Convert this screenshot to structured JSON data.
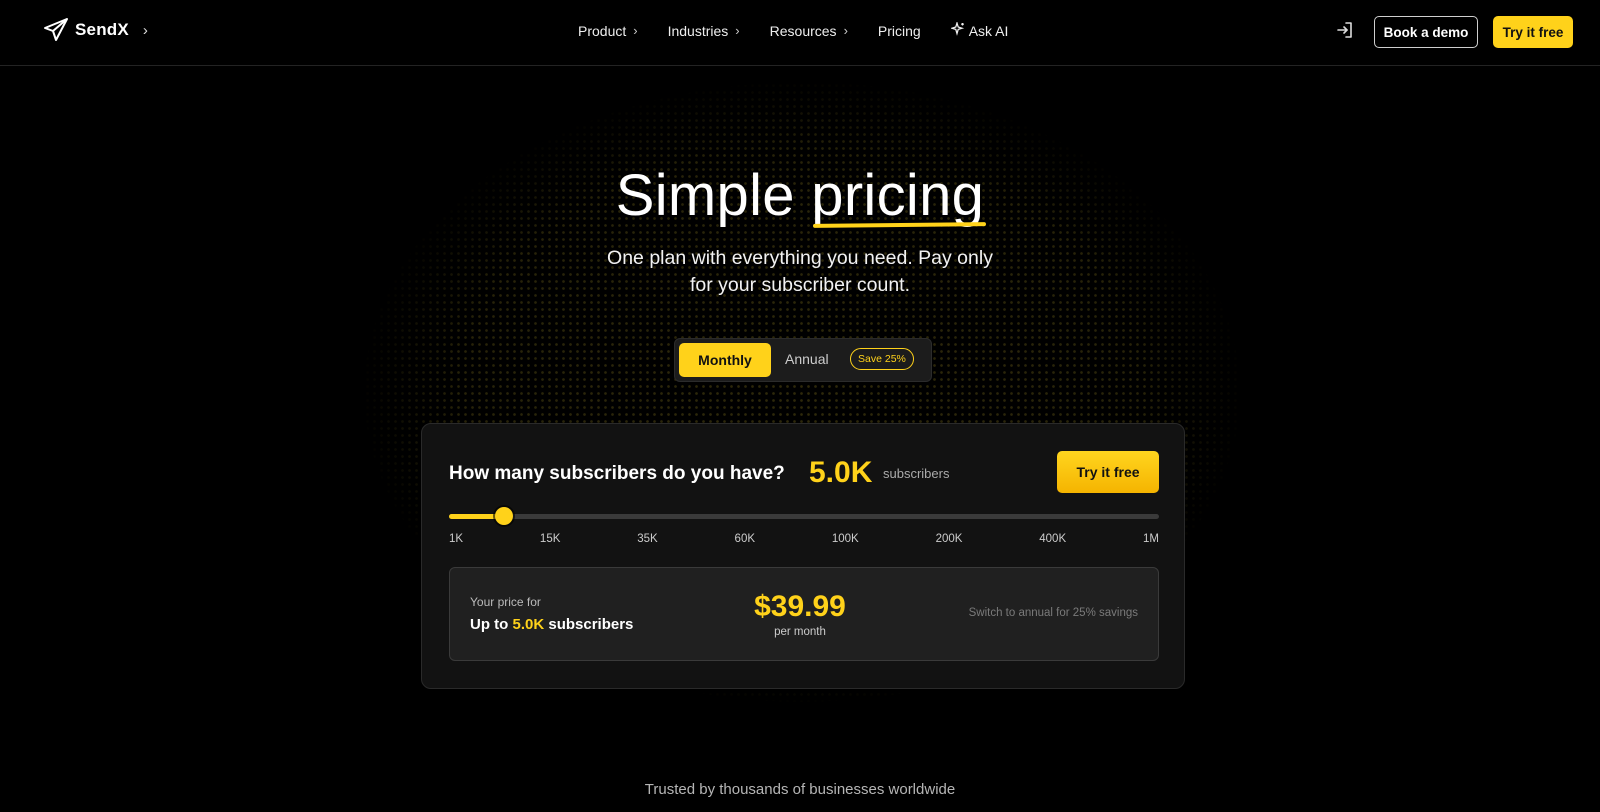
{
  "nav": {
    "logo_text": "SendX",
    "logo_chevron": "›",
    "menu": [
      {
        "label": "Product",
        "chevron": "›"
      },
      {
        "label": "Industries",
        "chevron": "›"
      },
      {
        "label": "Resources",
        "chevron": "›"
      },
      {
        "label": "Pricing"
      },
      {
        "label": "Ask AI",
        "icon": "sparkle-icon"
      }
    ],
    "signin_icon": "sign-in-icon",
    "book_demo_label": "Book a demo",
    "try_free_label": "Try it free"
  },
  "hero": {
    "title_plain": "Simple ",
    "title_highlight": "pricing",
    "subtitle": "One plan with everything you need. Pay only for your subscriber count.",
    "toggle": {
      "monthly_label": "Monthly",
      "annual_label": "Annual",
      "save_badge": "Save 25%",
      "selected": "Monthly"
    }
  },
  "calculator": {
    "question": "How many subscribers do you have?",
    "subscriber_value": "5.0K",
    "subscriber_unit": "subscribers",
    "try_free_label": "Try it free",
    "slider": {
      "ticks": [
        "1K",
        "15K",
        "35K",
        "60K",
        "100K",
        "200K",
        "400K",
        "1M"
      ],
      "level_fraction": 0.077
    },
    "price_box": {
      "label": "Your price for",
      "upto_prefix": "Up to ",
      "upto_value": "5.0K",
      "upto_suffix": " subscribers",
      "price": "$39.99",
      "period": "per month",
      "hint": "Switch to annual for 25% savings"
    }
  },
  "footer": {
    "trusted_text": "Trusted by thousands of businesses worldwide"
  },
  "colors": {
    "accent": "#ffd21a",
    "background": "#000000",
    "card": "#121212"
  }
}
